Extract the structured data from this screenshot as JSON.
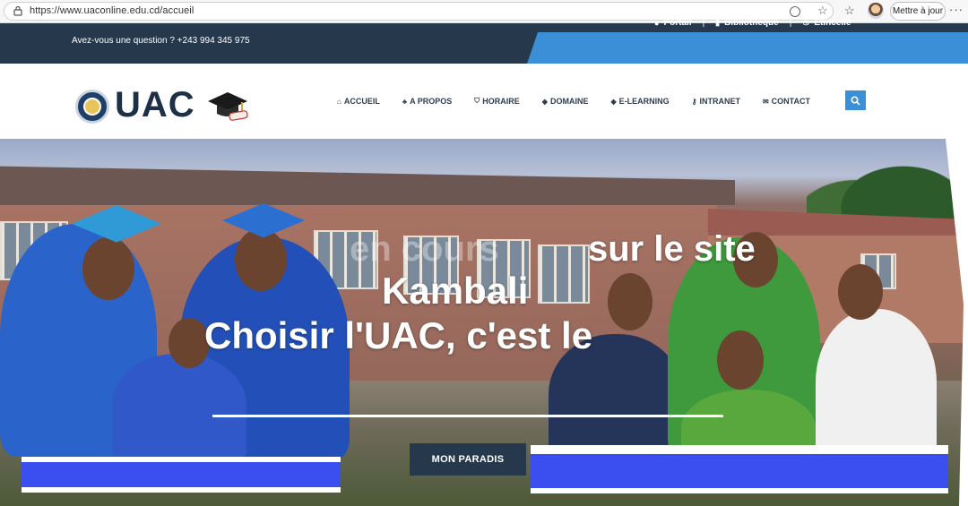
{
  "browser": {
    "url": "https://www.uaconline.edu.cd/accueil",
    "update_label": "Mettre à jour",
    "menu_label": "···"
  },
  "topbar": {
    "question": "Avez-vous une question ? +243 994 345 975",
    "links": [
      {
        "label": "Portail",
        "icon": "user-icon"
      },
      {
        "label": "Bibliothèque",
        "icon": "book-icon"
      },
      {
        "label": "Etincelle",
        "icon": "flame-icon"
      }
    ],
    "separator": "|"
  },
  "header": {
    "logo_text": "UAC",
    "nav": [
      {
        "label": "ACCUEIL",
        "icon": "home-icon",
        "glyph": "⌂"
      },
      {
        "label": "A PROPOS",
        "icon": "people-icon",
        "glyph": "♣"
      },
      {
        "label": "HORAIRE",
        "icon": "shield-icon",
        "glyph": "⛉"
      },
      {
        "label": "DOMAINE",
        "icon": "graduation-icon",
        "glyph": "◆"
      },
      {
        "label": "E-LEARNING",
        "icon": "graduation-icon",
        "glyph": "◆"
      },
      {
        "label": "INTRANET",
        "icon": "key-icon",
        "glyph": "⚷"
      },
      {
        "label": "CONTACT",
        "icon": "envelope-icon",
        "glyph": "✉"
      }
    ]
  },
  "hero": {
    "line1_ghost": "en cours",
    "line1": "sur le site",
    "line2": "Kambali",
    "line3": "Choisir l'UAC, c'est le",
    "cta_label": "MON PARADIS"
  },
  "colors": {
    "navy": "#26384c",
    "accent_blue": "#3a8fd6",
    "strip_blue": "#3b4ff0"
  }
}
